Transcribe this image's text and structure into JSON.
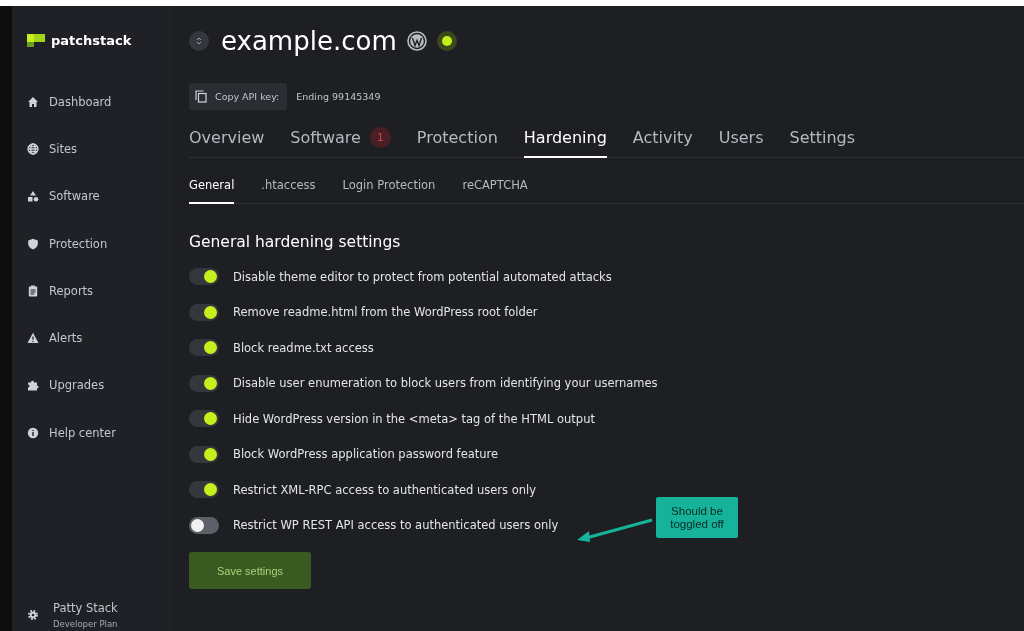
{
  "sidebar": {
    "logo": "patchstack",
    "items": [
      {
        "label": "Dashboard",
        "selected": false
      },
      {
        "label": "Sites",
        "selected": false
      },
      {
        "label": "Software",
        "selected": false
      },
      {
        "label": "Protection",
        "selected": false
      },
      {
        "label": "Reports",
        "selected": false
      },
      {
        "label": "Alerts",
        "selected": false
      },
      {
        "label": "Upgrades",
        "selected": false
      },
      {
        "label": "Help center",
        "selected": false
      }
    ],
    "user": {
      "name": "Patty Stack",
      "plan": "Developer Plan"
    }
  },
  "site": {
    "title": "example.com",
    "online": true
  },
  "api_key": {
    "button": "Copy API key:",
    "value": "Ending 99145349"
  },
  "tabs": [
    {
      "label": "Overview",
      "selected": false
    },
    {
      "label": "Software",
      "selected": false,
      "badge": "1"
    },
    {
      "label": "Protection",
      "selected": false
    },
    {
      "label": "Hardening",
      "selected": true
    },
    {
      "label": "Activity",
      "selected": false
    },
    {
      "label": "Users",
      "selected": false
    },
    {
      "label": "Settings",
      "selected": false
    }
  ],
  "subtabs": [
    {
      "label": "General",
      "selected": true
    },
    {
      "label": ".htaccess",
      "selected": false
    },
    {
      "label": "Login Protection",
      "selected": false
    },
    {
      "label": "reCAPTCHA",
      "selected": false
    }
  ],
  "section_title": "General hardening settings",
  "settings": [
    {
      "label": "Disable theme editor to protect from potential automated attacks",
      "on": true
    },
    {
      "label": "Remove readme.html from the WordPress root folder",
      "on": true
    },
    {
      "label": "Block readme.txt access",
      "on": true
    },
    {
      "label": "Disable user enumeration to block users from identifying your usernames",
      "on": true
    },
    {
      "label": "Hide WordPress version in the <meta> tag of the HTML output",
      "on": true
    },
    {
      "label": "Block WordPress application password feature",
      "on": true
    },
    {
      "label": "Restrict XML-RPC access to authenticated users only",
      "on": true
    },
    {
      "label": "Restrict WP REST API access to authenticated users only",
      "on": false
    }
  ],
  "save_button": "Save settings",
  "annotation": {
    "text": "Should be toggled off"
  }
}
